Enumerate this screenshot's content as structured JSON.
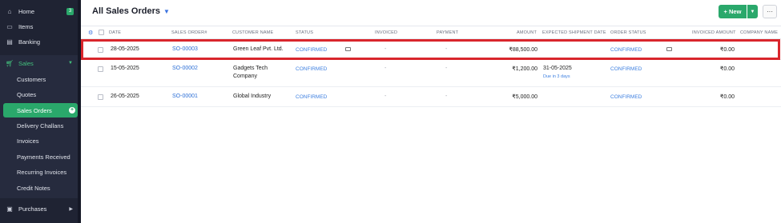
{
  "sidebar": {
    "home": "Home",
    "home_badge": "3",
    "items": "Items",
    "banking": "Banking",
    "sales": "Sales",
    "sub": [
      "Customers",
      "Quotes",
      "Sales Orders",
      "Delivery Challans",
      "Invoices",
      "Payments Received",
      "Recurring Invoices",
      "Credit Notes"
    ],
    "purchases": "Purchases"
  },
  "header": {
    "title": "All Sales Orders",
    "new_label": "+ New",
    "more_label": "···"
  },
  "table": {
    "columns": {
      "date": "DATE",
      "order": "SALES ORDER#",
      "customer": "CUSTOMER NAME",
      "status": "STATUS",
      "invoiced": "INVOICED",
      "payment": "PAYMENT",
      "amount": "AMOUNT",
      "shipment": "EXPECTED SHIPMENT DATE",
      "order_status": "ORDER STATUS",
      "invoiced_amount": "INVOICED AMOUNT",
      "company": "COMPANY NAME"
    },
    "rows": [
      {
        "date": "28-05-2025",
        "order": "SO-00003",
        "customer": "Green Leaf Pvt. Ltd.",
        "status": "CONFIRMED",
        "invoiced": "-",
        "payment": "-",
        "amount": "₹88,500.00",
        "shipment": "",
        "due": "",
        "order_status": "CONFIRMED",
        "invoiced_amount": "₹0.00"
      },
      {
        "date": "15-05-2025",
        "order": "SO-00002",
        "customer": "Gadgets Tech Company",
        "status": "CONFIRMED",
        "invoiced": "-",
        "payment": "-",
        "amount": "₹1,200.00",
        "shipment": "31-05-2025",
        "due": "Due in 3 days",
        "order_status": "CONFIRMED",
        "invoiced_amount": "₹0.00"
      },
      {
        "date": "26-05-2025",
        "order": "SO-00001",
        "customer": "Global Industry",
        "status": "CONFIRMED",
        "invoiced": "-",
        "payment": "-",
        "amount": "₹5,000.00",
        "shipment": "",
        "due": "",
        "order_status": "CONFIRMED",
        "invoiced_amount": "₹0.00"
      }
    ]
  },
  "colors": {
    "accent_green": "#2aa86b",
    "link_blue": "#2d6fd6",
    "highlight_red": "#d9262c",
    "sidebar_bg": "#1f2333"
  }
}
